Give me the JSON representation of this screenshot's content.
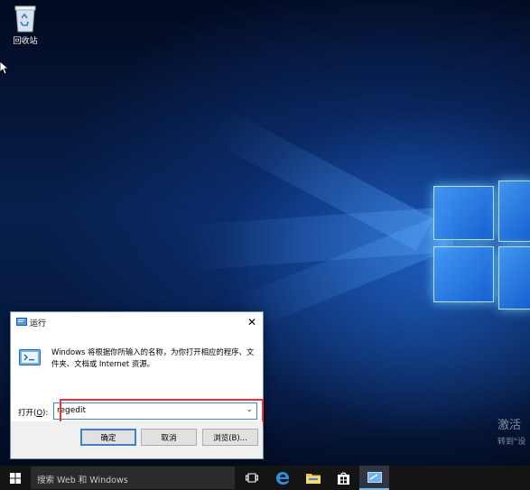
{
  "desktop": {
    "recycle_bin_label": "回收站",
    "watermark_title": "激活",
    "watermark_subtitle": "转到\"设"
  },
  "run_dialog": {
    "title": "运行",
    "description": "Windows 将根据你所输入的名称，为你打开相应的程序、文件夹、文档或 Internet 资源。",
    "open_label": "打开(",
    "open_hotkey": "O",
    "open_label_end": "):",
    "input_value": "regedit",
    "ok_label": "确定",
    "cancel_label": "取消",
    "browse_label": "浏览(B)...",
    "highlight_color": "#e0353b"
  },
  "taskbar": {
    "search_placeholder": "搜索 Web 和 Windows",
    "icons": [
      "windows-start-icon",
      "task-view-icon",
      "edge-icon",
      "file-explorer-icon",
      "store-icon",
      "run-icon"
    ],
    "accent_color": "#76b9ed"
  }
}
